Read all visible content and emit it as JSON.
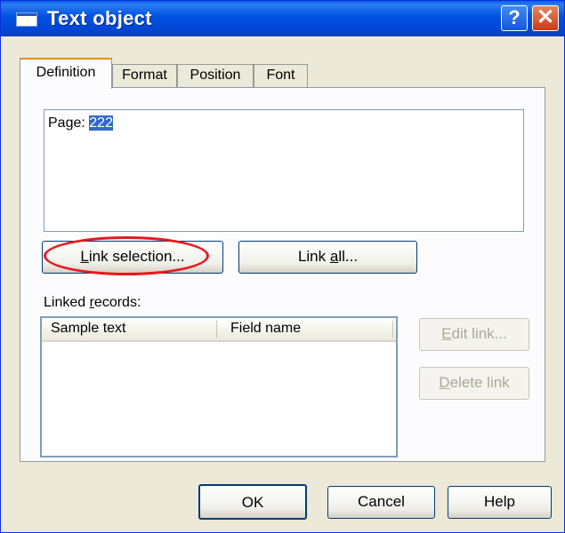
{
  "window": {
    "title": "Text object",
    "help_glyph": "?",
    "close_glyph": "✕",
    "icon": "window-icon"
  },
  "tabs": [
    {
      "label": "Definition",
      "active": true
    },
    {
      "label": "Format"
    },
    {
      "label": "Position"
    },
    {
      "label": "Font"
    }
  ],
  "definition": {
    "text_prefix": "Page: ",
    "text_selected": "222",
    "link_selection": {
      "mnemonic": "L",
      "rest": "ink selection..."
    },
    "link_all": {
      "before": "Link ",
      "mnemonic": "a",
      "rest": "ll..."
    },
    "linked_records_label": {
      "before": "Linked ",
      "mnemonic": "r",
      "rest": "ecords:"
    },
    "columns": [
      "Sample text",
      "Field name"
    ],
    "rows": [],
    "edit_link": {
      "mnemonic": "E",
      "rest": "dit link...",
      "enabled": false
    },
    "delete_link": {
      "mnemonic": "D",
      "rest": "elete link",
      "enabled": false
    }
  },
  "footer": {
    "ok": "OK",
    "cancel": "Cancel",
    "help": "Help"
  },
  "colors": {
    "titlebar": "#0050E0",
    "dialog_bg": "#ECE9D8",
    "selection": "#316AC5",
    "highlight_ellipse": "#E8181C"
  }
}
